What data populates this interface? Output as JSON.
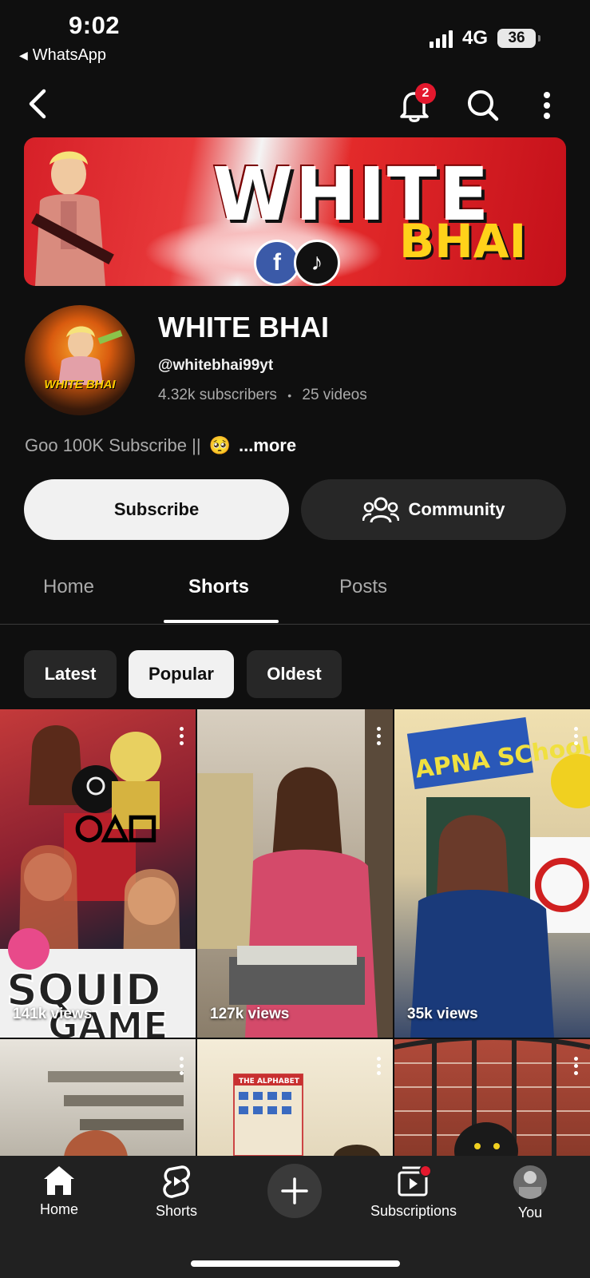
{
  "status_bar": {
    "time": "9:02",
    "back_app": "WhatsApp",
    "network": "4G",
    "battery": "36"
  },
  "app_bar": {
    "notification_count": "2",
    "icons": [
      "back-arrow-icon",
      "bell-icon",
      "search-icon",
      "more-vert-icon"
    ]
  },
  "banner": {
    "title": "WHITE",
    "subtitle": "BHAI"
  },
  "channel": {
    "avatar_text": "WHITE BHAI",
    "name": "WHITE BHAI",
    "handle": "@whitebhai99yt",
    "subscribers": "4.32k subscribers",
    "separator": "•",
    "videos": "25 videos",
    "description": "Goo 100K Subscribe ||",
    "description_emoji": "🥺",
    "more_label": "...more"
  },
  "actions": {
    "subscribe_label": "Subscribe",
    "community_label": "Community"
  },
  "tabs": [
    {
      "label": "Home",
      "active": false
    },
    {
      "label": "Shorts",
      "active": true
    },
    {
      "label": "Posts",
      "active": false
    }
  ],
  "filters": [
    {
      "label": "Latest",
      "active": false
    },
    {
      "label": "Popular",
      "active": true
    },
    {
      "label": "Oldest",
      "active": false
    }
  ],
  "shorts": [
    {
      "views": "141k views",
      "thumb_overlay": "SQUID GAME"
    },
    {
      "views": "127k views"
    },
    {
      "views": "35k views",
      "thumb_overlay": "APNA SChooL"
    },
    {
      "views": ""
    },
    {
      "views": "",
      "thumb_overlay": "THE ALPHABET"
    },
    {
      "views": ""
    }
  ],
  "bottom_nav": [
    {
      "label": "Home",
      "icon": "home-icon"
    },
    {
      "label": "Shorts",
      "icon": "shorts-icon"
    },
    {
      "label": "",
      "icon": "plus-icon"
    },
    {
      "label": "Subscriptions",
      "icon": "subscriptions-icon"
    },
    {
      "label": "You",
      "icon": "avatar"
    }
  ],
  "colors": {
    "background": "#0f0f0f",
    "chip_bg": "#272727",
    "active_chip_bg": "#f1f1f1",
    "badge_red": "#e3182d",
    "banner_red": "#d62028",
    "banner_yellow": "#ffd21a"
  }
}
